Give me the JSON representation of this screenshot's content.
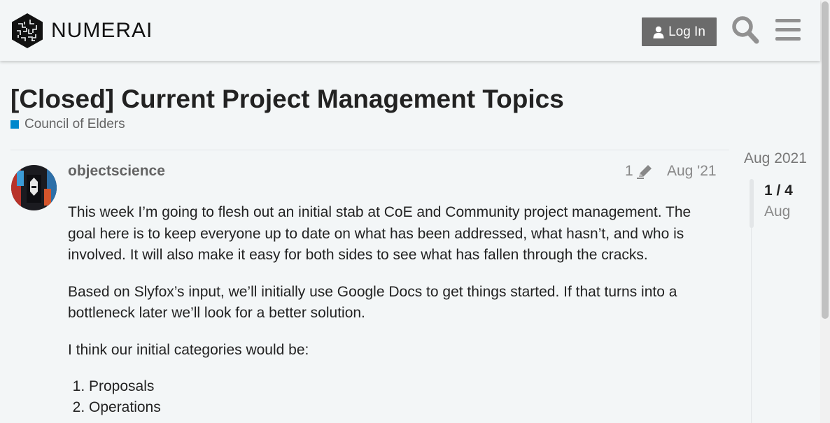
{
  "header": {
    "logo_text": "NUMERAI",
    "login_label": "Log In",
    "search_icon": "search-icon",
    "menu_icon": "hamburger-menu-icon"
  },
  "topic": {
    "title": "[Closed] Current Project Management Topics",
    "category": "Council of Elders",
    "category_color": "#0088cc"
  },
  "post": {
    "username": "objectscience",
    "edit_count": "1",
    "date": "Aug '21",
    "paragraphs": [
      "This week I’m going to flesh out an initial stab at CoE and Community project management. The goal here is to keep everyone up to date on what has been addressed, what hasn’t, and who is involved. It will also make it easy for both sides to see what has fallen through the cracks.",
      "Based on Slyfox’s input, we’ll initially use Google Docs to get things started. If that turns into a bottleneck later we’ll look for a better solution.",
      "I think our initial categories would be:"
    ],
    "list": [
      "Proposals",
      "Operations"
    ]
  },
  "timeline": {
    "top_date": "Aug 2021",
    "position": "1 / 4",
    "month": "Aug"
  }
}
